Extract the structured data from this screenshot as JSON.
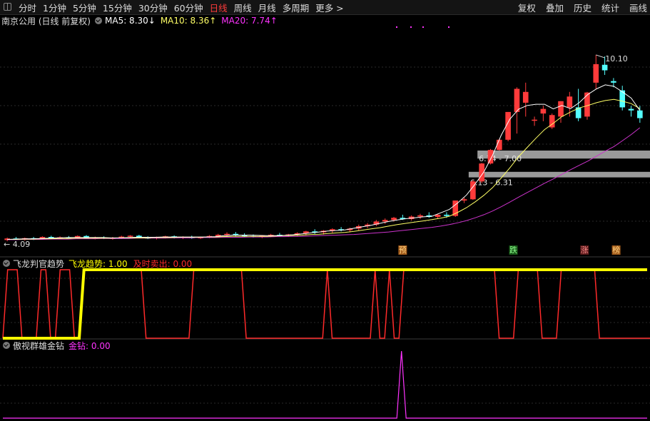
{
  "toolbar": {
    "periods": [
      "分时",
      "1分钟",
      "5分钟",
      "15分钟",
      "30分钟",
      "60分钟",
      "日线",
      "周线",
      "月线",
      "多周期",
      "更多 >"
    ],
    "active_period": "日线",
    "tools": [
      "复权",
      "叠加",
      "历史",
      "统计",
      "画线"
    ]
  },
  "main_legend": {
    "title": "南京公用 (日线 前复权)",
    "ma5": "MA5: 8.30↓",
    "ma10": "MA10: 8.36↑",
    "ma20": "MA20: 7.74↑",
    "colors": {
      "ma5": "#ffffff",
      "ma10": "#ffff66",
      "ma20": "#ff33ff"
    }
  },
  "indicator1": {
    "name": "飞龙判官趋势",
    "line1": "飞龙趋势: 1.00",
    "line2": "及时卖出: 0.00",
    "colors": {
      "line1": "#ffff00",
      "line2": "#ff2a2a"
    }
  },
  "indicator2": {
    "name": "傲视群雄金钻",
    "line1": "金钻: 0.00",
    "colors": {
      "line1": "#ff33ff"
    }
  },
  "chart_data": [
    {
      "type": "candlestick",
      "up_color": "#ff3b3b",
      "down_color": "#54ffff",
      "ylim": [
        3.6,
        11.0
      ],
      "high_label": "10.10",
      "low_label": "4.09",
      "zones": [
        "6.74 - 7.00",
        "6.13 - 6.31"
      ],
      "zone_ranges": [
        [
          6.74,
          7.0
        ],
        [
          6.13,
          6.31
        ]
      ],
      "markers": [
        "预",
        "跌",
        "涨",
        "榜"
      ],
      "candles": [
        {
          "o": 4.1,
          "h": 4.18,
          "l": 4.06,
          "c": 4.15
        },
        {
          "o": 4.15,
          "h": 4.2,
          "l": 4.1,
          "c": 4.12
        },
        {
          "o": 4.12,
          "h": 4.18,
          "l": 4.08,
          "c": 4.16
        },
        {
          "o": 4.16,
          "h": 4.2,
          "l": 4.1,
          "c": 4.13
        },
        {
          "o": 4.13,
          "h": 4.22,
          "l": 4.11,
          "c": 4.2
        },
        {
          "o": 4.2,
          "h": 4.24,
          "l": 4.14,
          "c": 4.16
        },
        {
          "o": 4.16,
          "h": 4.22,
          "l": 4.12,
          "c": 4.19
        },
        {
          "o": 4.19,
          "h": 4.23,
          "l": 4.15,
          "c": 4.17
        },
        {
          "o": 4.17,
          "h": 4.25,
          "l": 4.15,
          "c": 4.23
        },
        {
          "o": 4.23,
          "h": 4.26,
          "l": 4.14,
          "c": 4.15
        },
        {
          "o": 4.15,
          "h": 4.21,
          "l": 4.12,
          "c": 4.18
        },
        {
          "o": 4.18,
          "h": 4.22,
          "l": 4.13,
          "c": 4.15
        },
        {
          "o": 4.15,
          "h": 4.2,
          "l": 4.11,
          "c": 4.17
        },
        {
          "o": 4.17,
          "h": 4.24,
          "l": 4.14,
          "c": 4.21
        },
        {
          "o": 4.21,
          "h": 4.26,
          "l": 4.16,
          "c": 4.24
        },
        {
          "o": 4.24,
          "h": 4.27,
          "l": 4.16,
          "c": 4.18
        },
        {
          "o": 4.18,
          "h": 4.22,
          "l": 4.13,
          "c": 4.16
        },
        {
          "o": 4.16,
          "h": 4.21,
          "l": 4.12,
          "c": 4.19
        },
        {
          "o": 4.19,
          "h": 4.24,
          "l": 4.15,
          "c": 4.22
        },
        {
          "o": 4.22,
          "h": 4.25,
          "l": 4.15,
          "c": 4.17
        },
        {
          "o": 4.17,
          "h": 4.22,
          "l": 4.13,
          "c": 4.2
        },
        {
          "o": 4.2,
          "h": 4.24,
          "l": 4.14,
          "c": 4.16
        },
        {
          "o": 4.16,
          "h": 4.21,
          "l": 4.13,
          "c": 4.19
        },
        {
          "o": 4.19,
          "h": 4.26,
          "l": 4.16,
          "c": 4.23
        },
        {
          "o": 4.23,
          "h": 4.3,
          "l": 4.18,
          "c": 4.27
        },
        {
          "o": 4.27,
          "h": 4.35,
          "l": 4.22,
          "c": 4.3
        },
        {
          "o": 4.3,
          "h": 4.36,
          "l": 4.22,
          "c": 4.26
        },
        {
          "o": 4.26,
          "h": 4.32,
          "l": 4.2,
          "c": 4.23
        },
        {
          "o": 4.23,
          "h": 4.28,
          "l": 4.18,
          "c": 4.2
        },
        {
          "o": 4.2,
          "h": 4.26,
          "l": 4.16,
          "c": 4.24
        },
        {
          "o": 4.24,
          "h": 4.3,
          "l": 4.19,
          "c": 4.27
        },
        {
          "o": 4.27,
          "h": 4.33,
          "l": 4.22,
          "c": 4.24
        },
        {
          "o": 4.24,
          "h": 4.3,
          "l": 4.2,
          "c": 4.28
        },
        {
          "o": 4.28,
          "h": 4.35,
          "l": 4.23,
          "c": 4.32
        },
        {
          "o": 4.32,
          "h": 4.4,
          "l": 4.25,
          "c": 4.38
        },
        {
          "o": 4.38,
          "h": 4.45,
          "l": 4.3,
          "c": 4.35
        },
        {
          "o": 4.35,
          "h": 4.42,
          "l": 4.28,
          "c": 4.4
        },
        {
          "o": 4.4,
          "h": 4.48,
          "l": 4.33,
          "c": 4.45
        },
        {
          "o": 4.45,
          "h": 4.52,
          "l": 4.38,
          "c": 4.42
        },
        {
          "o": 4.42,
          "h": 4.5,
          "l": 4.35,
          "c": 4.47
        },
        {
          "o": 4.47,
          "h": 4.6,
          "l": 4.4,
          "c": 4.55
        },
        {
          "o": 4.55,
          "h": 4.65,
          "l": 4.48,
          "c": 4.6
        },
        {
          "o": 4.6,
          "h": 4.75,
          "l": 4.55,
          "c": 4.7
        },
        {
          "o": 4.7,
          "h": 4.8,
          "l": 4.62,
          "c": 4.75
        },
        {
          "o": 4.75,
          "h": 4.85,
          "l": 4.7,
          "c": 4.82
        },
        {
          "o": 4.82,
          "h": 4.92,
          "l": 4.75,
          "c": 4.78
        },
        {
          "o": 4.78,
          "h": 4.9,
          "l": 4.73,
          "c": 4.86
        },
        {
          "o": 4.86,
          "h": 4.95,
          "l": 4.78,
          "c": 4.9
        },
        {
          "o": 4.9,
          "h": 5.0,
          "l": 4.82,
          "c": 4.85
        },
        {
          "o": 4.85,
          "h": 4.95,
          "l": 4.8,
          "c": 4.92
        },
        {
          "o": 4.92,
          "h": 5.0,
          "l": 4.82,
          "c": 4.88
        },
        {
          "o": 4.88,
          "h": 5.05,
          "l": 4.85,
          "c": 5.38
        },
        {
          "o": 5.38,
          "h": 5.48,
          "l": 5.3,
          "c": 5.42
        },
        {
          "o": 5.42,
          "h": 6.05,
          "l": 5.4,
          "c": 6.0
        },
        {
          "o": 6.0,
          "h": 6.6,
          "l": 5.95,
          "c": 6.58
        },
        {
          "o": 6.58,
          "h": 7.05,
          "l": 6.55,
          "c": 7.02
        },
        {
          "o": 7.02,
          "h": 7.38,
          "l": 7.0,
          "c": 7.35
        },
        {
          "o": 7.35,
          "h": 8.25,
          "l": 7.3,
          "c": 8.25
        },
        {
          "o": 8.25,
          "h": 9.05,
          "l": 7.55,
          "c": 9.0
        },
        {
          "o": 8.55,
          "h": 9.2,
          "l": 8.1,
          "c": 8.9
        },
        {
          "o": 8.0,
          "h": 8.1,
          "l": 7.8,
          "c": 8.0
        },
        {
          "o": 8.2,
          "h": 8.45,
          "l": 7.95,
          "c": 8.35
        },
        {
          "o": 7.75,
          "h": 8.2,
          "l": 7.7,
          "c": 8.15
        },
        {
          "o": 8.1,
          "h": 8.6,
          "l": 7.9,
          "c": 8.6
        },
        {
          "o": 8.4,
          "h": 8.9,
          "l": 8.1,
          "c": 8.75
        },
        {
          "o": 8.4,
          "h": 9.0,
          "l": 7.95,
          "c": 8.05
        },
        {
          "o": 8.1,
          "h": 8.9,
          "l": 8.0,
          "c": 8.88
        },
        {
          "o": 9.2,
          "h": 10.1,
          "l": 9.0,
          "c": 9.8
        },
        {
          "o": 9.78,
          "h": 10.05,
          "l": 9.45,
          "c": 9.6
        },
        {
          "o": 9.25,
          "h": 9.35,
          "l": 9.05,
          "c": 9.2
        },
        {
          "o": 8.95,
          "h": 9.1,
          "l": 8.3,
          "c": 8.4
        },
        {
          "o": 8.35,
          "h": 8.45,
          "l": 8.1,
          "c": 8.3
        },
        {
          "o": 8.3,
          "h": 8.45,
          "l": 7.9,
          "c": 8.05
        }
      ],
      "ma5": [
        4.12,
        4.13,
        4.14,
        4.14,
        4.15,
        4.16,
        4.17,
        4.18,
        4.18,
        4.18,
        4.18,
        4.18,
        4.17,
        4.17,
        4.18,
        4.19,
        4.19,
        4.19,
        4.2,
        4.2,
        4.2,
        4.2,
        4.2,
        4.2,
        4.21,
        4.24,
        4.26,
        4.26,
        4.26,
        4.25,
        4.24,
        4.24,
        4.25,
        4.27,
        4.3,
        4.33,
        4.36,
        4.39,
        4.41,
        4.43,
        4.48,
        4.53,
        4.58,
        4.64,
        4.7,
        4.75,
        4.79,
        4.82,
        4.85,
        4.87,
        4.98,
        5.09,
        5.31,
        5.56,
        5.92,
        6.31,
        6.85,
        7.5,
        8.02,
        8.34,
        8.46,
        8.5,
        8.5,
        8.35,
        8.46,
        8.36,
        8.55,
        8.82,
        9.0,
        9.13,
        9.08,
        8.9,
        8.7,
        8.3
      ],
      "ma10": [
        4.12,
        4.12,
        4.13,
        4.13,
        4.14,
        4.14,
        4.15,
        4.15,
        4.16,
        4.16,
        4.16,
        4.16,
        4.16,
        4.17,
        4.17,
        4.17,
        4.17,
        4.18,
        4.18,
        4.18,
        4.19,
        4.19,
        4.19,
        4.2,
        4.2,
        4.21,
        4.22,
        4.22,
        4.22,
        4.22,
        4.22,
        4.23,
        4.24,
        4.25,
        4.26,
        4.28,
        4.29,
        4.31,
        4.33,
        4.35,
        4.38,
        4.42,
        4.46,
        4.5,
        4.55,
        4.6,
        4.64,
        4.68,
        4.72,
        4.76,
        4.81,
        4.87,
        5.0,
        5.15,
        5.34,
        5.55,
        5.8,
        6.11,
        6.44,
        6.8,
        7.1,
        7.4,
        7.68,
        7.88,
        8.1,
        8.25,
        8.38,
        8.46,
        8.55,
        8.62,
        8.66,
        8.6,
        8.52,
        8.36
      ],
      "ma20": [
        4.11,
        4.11,
        4.12,
        4.12,
        4.12,
        4.13,
        4.13,
        4.13,
        4.14,
        4.14,
        4.14,
        4.15,
        4.15,
        4.15,
        4.15,
        4.16,
        4.16,
        4.16,
        4.16,
        4.17,
        4.17,
        4.17,
        4.18,
        4.18,
        4.18,
        4.19,
        4.19,
        4.19,
        4.2,
        4.2,
        4.2,
        4.21,
        4.21,
        4.22,
        4.22,
        4.23,
        4.24,
        4.25,
        4.26,
        4.27,
        4.28,
        4.3,
        4.32,
        4.34,
        4.36,
        4.39,
        4.42,
        4.45,
        4.48,
        4.51,
        4.55,
        4.6,
        4.66,
        4.73,
        4.82,
        4.92,
        5.04,
        5.18,
        5.33,
        5.49,
        5.64,
        5.79,
        5.94,
        6.08,
        6.23,
        6.38,
        6.52,
        6.66,
        6.82,
        6.98,
        7.13,
        7.32,
        7.52,
        7.74
      ]
    },
    {
      "type": "line",
      "title": "飞龙判官趋势",
      "ylim": [
        0,
        1
      ],
      "series": [
        {
          "name": "飞龙趋势",
          "values": [
            0,
            0,
            0,
            0,
            0,
            0,
            0,
            0,
            0,
            0,
            0,
            0,
            0,
            0,
            0,
            0,
            0,
            1,
            1,
            1,
            1,
            1,
            1,
            1,
            1,
            1,
            1,
            1,
            1,
            1,
            1,
            1,
            1,
            1,
            1,
            1,
            1,
            1,
            1,
            1,
            1,
            1,
            1,
            1,
            1,
            1,
            1,
            1,
            1,
            1,
            1,
            1,
            1,
            1,
            1,
            1,
            1,
            1,
            1,
            1,
            1,
            1,
            1,
            1,
            1,
            1,
            1,
            1,
            1,
            1,
            1,
            1,
            1,
            1,
            1,
            1,
            1,
            1,
            1,
            1,
            1,
            1,
            1,
            1,
            1,
            1,
            1,
            1,
            1,
            1,
            1,
            1,
            1,
            1,
            1,
            1,
            1,
            1,
            1,
            1,
            1,
            1,
            1,
            1,
            1,
            1,
            1,
            1,
            1,
            1,
            1,
            1,
            1,
            1,
            1,
            1,
            1,
            1,
            1,
            1,
            1,
            1,
            1,
            1,
            1,
            1,
            1,
            1,
            1,
            1,
            1,
            1,
            1,
            1,
            1,
            1
          ]
        },
        {
          "name": "及时卖出",
          "values": [
            0,
            1,
            1,
            1,
            0,
            0,
            0,
            0,
            1,
            1,
            0,
            0,
            1,
            1,
            1,
            0,
            0,
            1,
            1,
            1,
            1,
            1,
            1,
            1,
            1,
            1,
            1,
            1,
            1,
            1,
            0,
            0,
            0,
            0,
            0,
            0,
            0,
            0,
            0,
            0,
            1,
            1,
            1,
            1,
            1,
            1,
            1,
            1,
            1,
            1,
            1,
            0,
            0,
            0,
            0,
            0,
            0,
            0,
            0,
            0,
            0,
            0,
            0,
            0,
            0,
            0,
            0,
            0,
            1,
            0,
            0,
            0,
            0,
            0,
            0,
            0,
            0,
            0,
            1,
            0,
            0,
            1,
            0,
            0,
            1,
            1,
            1,
            1,
            1,
            1,
            1,
            1,
            1,
            1,
            1,
            1,
            1,
            1,
            1,
            1,
            1,
            1,
            1,
            1,
            0,
            0,
            0,
            0,
            1,
            1,
            1,
            1,
            1,
            0,
            0,
            0,
            0,
            1,
            1,
            1,
            1,
            1,
            1,
            1,
            1,
            0,
            0,
            0,
            0,
            0,
            0,
            0,
            0,
            0,
            0,
            0,
            0,
            0,
            0,
            0
          ]
        }
      ]
    },
    {
      "type": "line",
      "title": "傲视群雄金钻",
      "ylim": [
        0,
        1
      ],
      "series": [
        {
          "name": "金钻",
          "values": [
            0,
            0,
            0,
            0,
            0,
            0,
            0,
            0,
            0,
            0,
            0,
            0,
            0,
            0,
            0,
            0,
            0,
            0,
            0,
            0,
            0,
            0,
            0,
            0,
            0,
            0,
            0,
            0,
            0,
            0,
            0,
            0,
            0,
            0,
            0,
            0,
            0,
            0,
            0,
            0,
            0,
            0,
            0,
            0,
            0,
            0,
            0,
            0,
            0,
            0,
            0,
            0,
            0,
            0,
            0,
            0,
            0,
            0,
            0,
            0,
            0,
            0,
            0,
            0,
            0,
            0,
            0,
            0,
            0,
            0,
            0,
            0,
            0,
            0,
            0,
            0,
            0,
            0,
            0,
            0,
            0,
            0,
            0,
            0,
            0,
            0,
            1,
            0,
            0,
            0,
            0,
            0,
            0,
            0,
            0,
            0,
            0,
            0,
            0,
            0,
            0,
            0,
            0,
            0,
            0,
            0,
            0,
            0,
            0,
            0,
            0,
            0,
            0,
            0,
            0,
            0,
            0,
            0,
            0,
            0,
            0,
            0,
            0,
            0,
            0,
            0,
            0,
            0,
            0,
            0,
            0,
            0,
            0,
            0,
            0,
            0,
            0,
            0,
            0,
            0
          ]
        }
      ]
    }
  ]
}
